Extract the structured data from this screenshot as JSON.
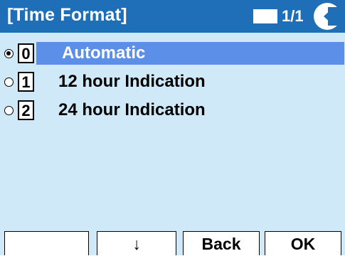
{
  "title_bar": {
    "title": "[Time Format]",
    "page_indicator": "1/1",
    "back_icon": "back-arrow-icon"
  },
  "options": [
    {
      "key": "0",
      "label": "Automatic",
      "selected": true,
      "highlighted": true
    },
    {
      "key": "1",
      "label": "12 hour Indication",
      "selected": false,
      "highlighted": false
    },
    {
      "key": "2",
      "label": "24 hour Indication",
      "selected": false,
      "highlighted": false
    }
  ],
  "softkeys": [
    {
      "label": ""
    },
    {
      "label": "↓"
    },
    {
      "label": "Back"
    },
    {
      "label": "OK"
    }
  ],
  "colors": {
    "title_bar": "#1e6fb8",
    "background": "#cfe9f9",
    "highlight": "#5b8fe8"
  }
}
